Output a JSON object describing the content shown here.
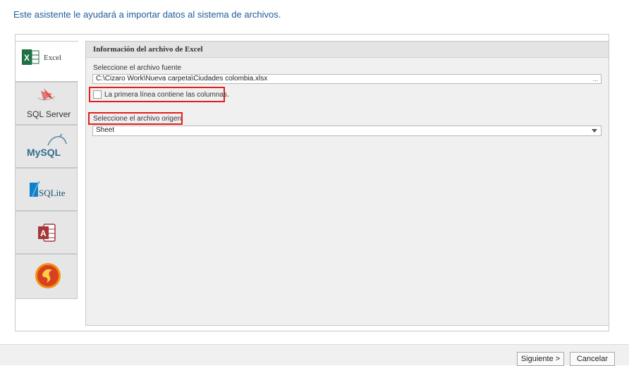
{
  "intro_text": "Este asistente le ayudará a importar datos al sistema de archivos.",
  "tabs": [
    {
      "label": "Excel",
      "icon": "excel-icon",
      "active": true
    },
    {
      "label": "SQL Server",
      "icon": "sql-server-icon",
      "active": false
    },
    {
      "label": "MySQL",
      "icon": "mysql-icon",
      "active": false
    },
    {
      "label": "SQLite",
      "icon": "sqlite-icon",
      "active": false
    },
    {
      "label": "",
      "icon": "access-icon",
      "active": false
    },
    {
      "label": "",
      "icon": "firebird-icon",
      "active": false
    }
  ],
  "excel_group": {
    "title": "Información del archivo de Excel",
    "source_label": "Seleccione el archivo fuente",
    "source_value": "C:\\Cizaro Work\\Nueva carpeta\\Ciudades colombia.xlsx",
    "browse_label": "...",
    "first_row_checkbox_label": "La primera línea contiene las columnas.",
    "first_row_checked": false,
    "origin_label": "Seleccione el archivo origen",
    "origin_value": "Sheet"
  },
  "footer": {
    "next_label": "Siguiente >",
    "cancel_label": "Cancelar"
  },
  "colors": {
    "intro_text": "#1f5c99",
    "highlight": "#e0201f",
    "excel_green": "#1e7145"
  }
}
